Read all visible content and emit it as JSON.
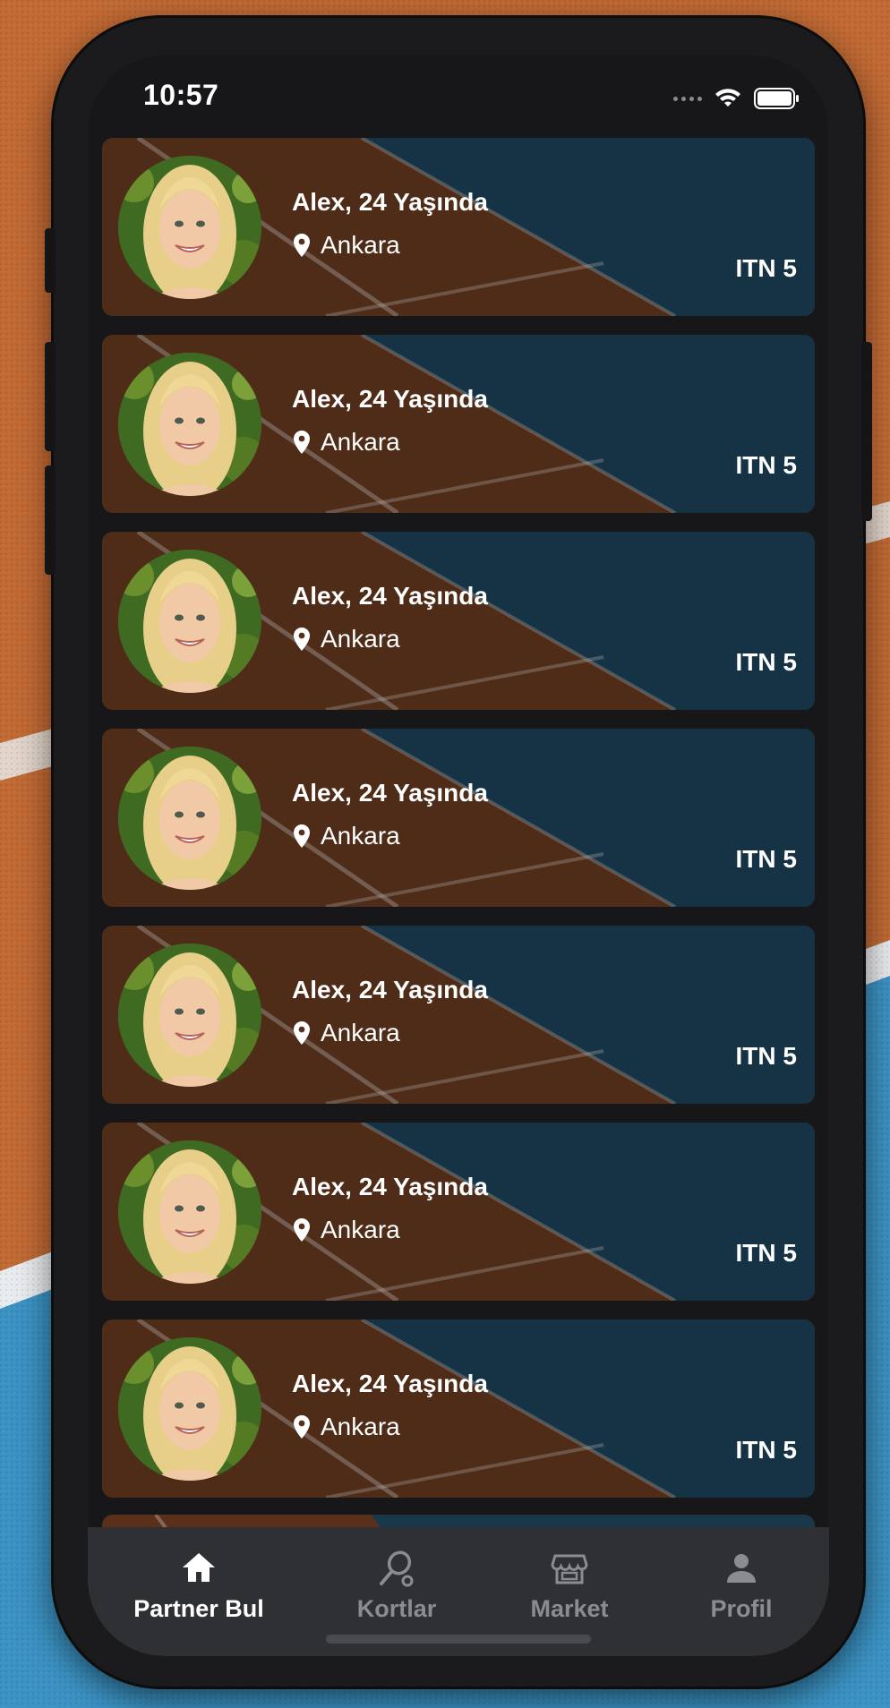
{
  "status": {
    "time": "10:57"
  },
  "partners": [
    {
      "name": "Alex, 24 Yaşında",
      "location": "Ankara",
      "level": "ITN 5"
    },
    {
      "name": "Alex, 24 Yaşında",
      "location": "Ankara",
      "level": "ITN 5"
    },
    {
      "name": "Alex, 24 Yaşında",
      "location": "Ankara",
      "level": "ITN 5"
    },
    {
      "name": "Alex, 24 Yaşında",
      "location": "Ankara",
      "level": "ITN 5"
    },
    {
      "name": "Alex, 24 Yaşında",
      "location": "Ankara",
      "level": "ITN 5"
    },
    {
      "name": "Alex, 24 Yaşında",
      "location": "Ankara",
      "level": "ITN 5"
    },
    {
      "name": "Alex, 24 Yaşında",
      "location": "Ankara",
      "level": "ITN 5"
    }
  ],
  "tabs": [
    {
      "label": "Partner Bul",
      "icon": "home-icon",
      "active": true
    },
    {
      "label": "Kortlar",
      "icon": "tennis-racket-icon",
      "active": false
    },
    {
      "label": "Market",
      "icon": "store-icon",
      "active": false
    },
    {
      "label": "Profil",
      "icon": "person-icon",
      "active": false
    }
  ],
  "colors": {
    "clay": "#8a4a26",
    "hardcourt": "#1f5a74",
    "tab_active": "#ffffff",
    "tab_inactive": "#8b8c90",
    "tab_bar": "#2f3033"
  }
}
